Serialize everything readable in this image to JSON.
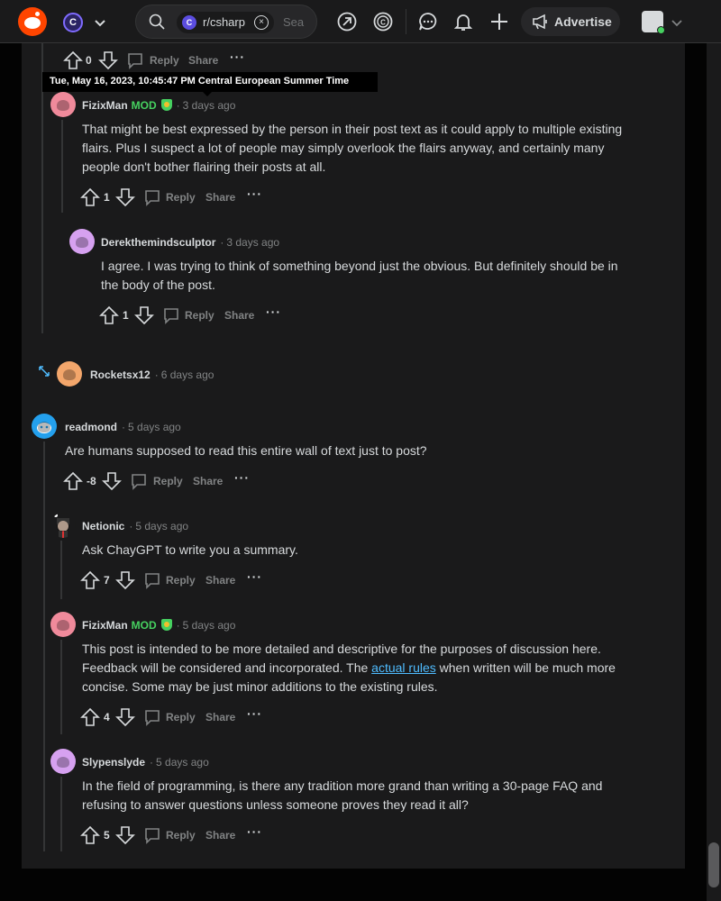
{
  "header": {
    "subreddit_chip": "r/csharp",
    "subreddit_initial": "C",
    "search_placeholder": "Sea",
    "advertise_label": "Advertise",
    "close_glyph": "×"
  },
  "tooltip": "Tue, May 16, 2023, 10:45:47 PM Central European Summer Time",
  "actions_common": {
    "reply": "Reply",
    "share": "Share",
    "more": "···"
  },
  "comments": [
    {
      "score": "0"
    },
    {
      "author": "FizixMan",
      "mod": "MOD",
      "time": "3 days ago",
      "body": "That might be best expressed by the person in their post text as it could apply to multiple existing flairs. Plus I suspect a lot of people may simply overlook the flairs anyway, and certainly many people don't bother flairing their posts at all.",
      "score": "1",
      "avatar_color": "#f08a9b"
    },
    {
      "author": "Derekthemindsculptor",
      "time": "3 days ago",
      "body": "I agree. I was trying to think of something beyond just the obvious. But definitely should be in the body of the post.",
      "score": "1",
      "avatar_color": "#d6a1f0"
    },
    {
      "author": "Rocketsx12",
      "time": "6 days ago",
      "avatar_color": "#f3a66b"
    },
    {
      "author": "readmond",
      "time": "5 days ago",
      "body": "Are humans supposed to read this entire wall of text just to post?",
      "score": "-8",
      "avatar_color": "#24a0ed"
    },
    {
      "author": "Netionic",
      "time": "5 days ago",
      "body": "Ask ChayGPT to write you a summary.",
      "score": "7",
      "avatar_color": "#2a2a2c"
    },
    {
      "author": "FizixMan",
      "mod": "MOD",
      "time": "5 days ago",
      "body_before": "This post is intended to be more detailed and descriptive for the purposes of discussion here. Feedback will be considered and incorporated. The ",
      "link_text": "actual rules",
      "body_after": " when written will be much more concise. Some may be just minor additions to the existing rules.",
      "score": "4",
      "avatar_color": "#f08a9b"
    },
    {
      "author": "Slypenslyde",
      "time": "5 days ago",
      "body": "In the field of programming, is there any tradition more grand than writing a 30-page FAQ and refusing to answer questions unless someone proves they read it all?",
      "score": "5",
      "avatar_color": "#d6a1f0"
    }
  ]
}
